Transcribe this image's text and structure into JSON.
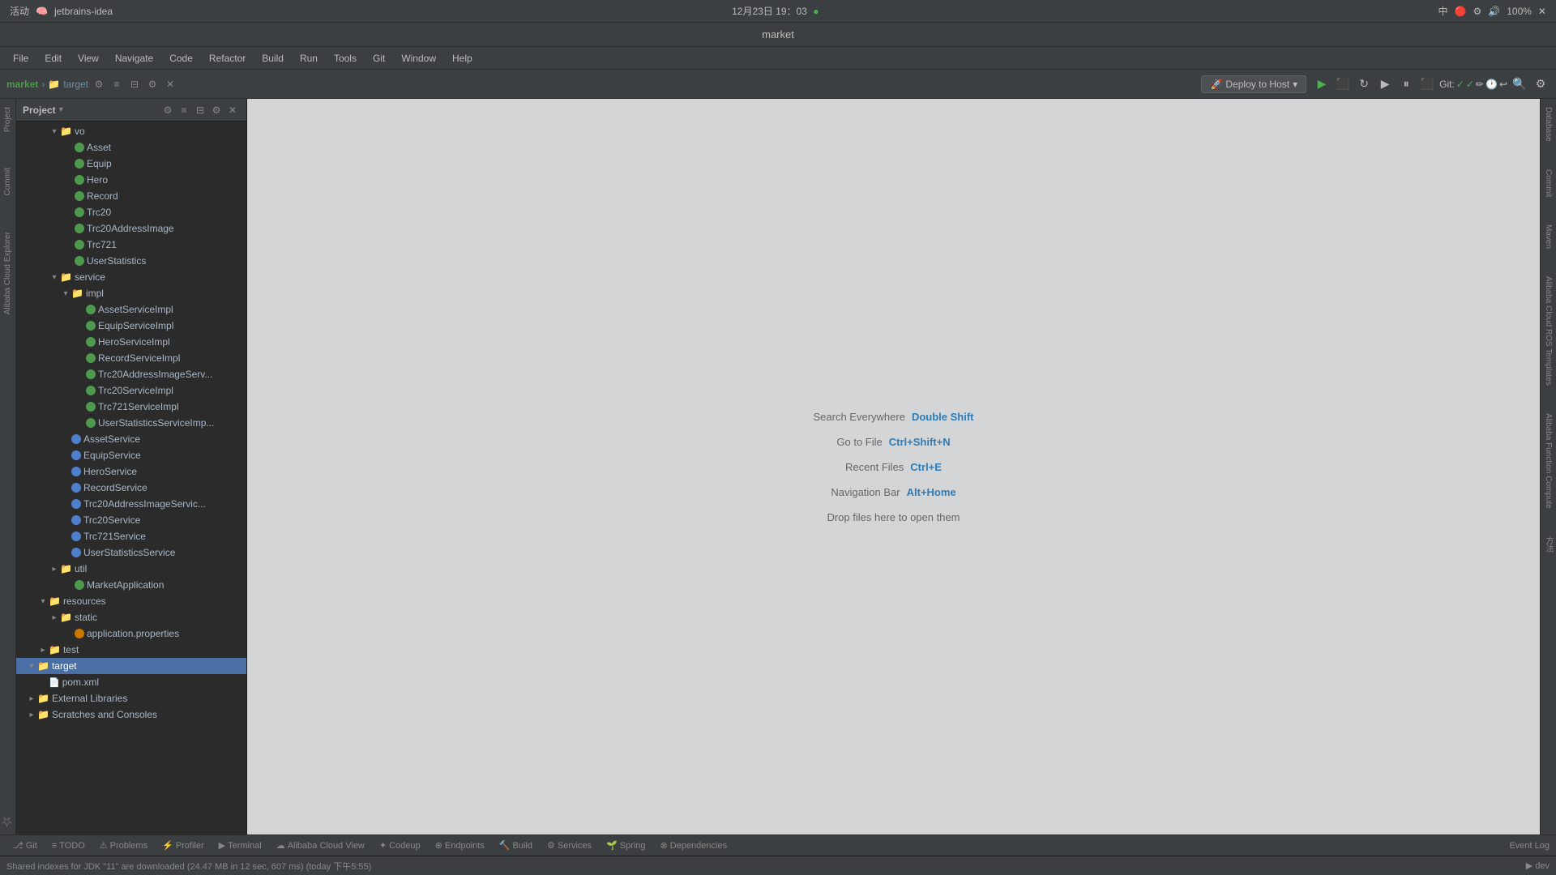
{
  "systemBar": {
    "leftText": "活动",
    "appName": "jetbrains-idea",
    "centerText": "12月23日 19：03",
    "indicator": "●",
    "rightText": "中",
    "battery": "100%"
  },
  "titleBar": {
    "title": "market"
  },
  "menuBar": {
    "items": [
      "File",
      "Edit",
      "View",
      "Navigate",
      "Code",
      "Refactor",
      "Build",
      "Run",
      "Tools",
      "Git",
      "Window",
      "Help"
    ]
  },
  "toolbar": {
    "project": "market",
    "separator": "›",
    "target": "target",
    "deployBtn": "Deploy to Host",
    "gitLabel": "Git:"
  },
  "projectPanel": {
    "title": "Project",
    "tree": [
      {
        "indent": 3,
        "type": "folder",
        "label": "vo",
        "collapsed": false
      },
      {
        "indent": 4,
        "type": "class",
        "label": "Asset",
        "color": "green"
      },
      {
        "indent": 4,
        "type": "class",
        "label": "Equip",
        "color": "green"
      },
      {
        "indent": 4,
        "type": "class",
        "label": "Hero",
        "color": "green"
      },
      {
        "indent": 4,
        "type": "class",
        "label": "Record",
        "color": "green"
      },
      {
        "indent": 4,
        "type": "class",
        "label": "Trc20",
        "color": "green"
      },
      {
        "indent": 4,
        "type": "class",
        "label": "Trc20AddressImage",
        "color": "green"
      },
      {
        "indent": 4,
        "type": "class",
        "label": "Trc721",
        "color": "green"
      },
      {
        "indent": 4,
        "type": "class",
        "label": "UserStatistics",
        "color": "green"
      },
      {
        "indent": 3,
        "type": "folder",
        "label": "service",
        "collapsed": false
      },
      {
        "indent": 4,
        "type": "folder",
        "label": "impl",
        "collapsed": false
      },
      {
        "indent": 5,
        "type": "class",
        "label": "AssetServiceImpl",
        "color": "green"
      },
      {
        "indent": 5,
        "type": "class",
        "label": "EquipServiceImpl",
        "color": "green"
      },
      {
        "indent": 5,
        "type": "class",
        "label": "HeroServiceImpl",
        "color": "green"
      },
      {
        "indent": 5,
        "type": "class",
        "label": "RecordServiceImpl",
        "color": "green"
      },
      {
        "indent": 5,
        "type": "class",
        "label": "Trc20AddressImageServ...",
        "color": "green"
      },
      {
        "indent": 5,
        "type": "class",
        "label": "Trc20ServiceImpl",
        "color": "green"
      },
      {
        "indent": 5,
        "type": "class",
        "label": "Trc721ServiceImpl",
        "color": "green"
      },
      {
        "indent": 5,
        "type": "class",
        "label": "UserStatisticsServiceImp...",
        "color": "green"
      },
      {
        "indent": 4,
        "type": "interface",
        "label": "AssetService",
        "color": "blue"
      },
      {
        "indent": 4,
        "type": "interface",
        "label": "EquipService",
        "color": "blue"
      },
      {
        "indent": 4,
        "type": "interface",
        "label": "HeroService",
        "color": "blue"
      },
      {
        "indent": 4,
        "type": "interface",
        "label": "RecordService",
        "color": "blue"
      },
      {
        "indent": 4,
        "type": "interface",
        "label": "Trc20AddressImageServic...",
        "color": "blue"
      },
      {
        "indent": 4,
        "type": "interface",
        "label": "Trc20Service",
        "color": "blue"
      },
      {
        "indent": 4,
        "type": "interface",
        "label": "Trc721Service",
        "color": "blue"
      },
      {
        "indent": 4,
        "type": "interface",
        "label": "UserStatisticsService",
        "color": "blue"
      },
      {
        "indent": 3,
        "type": "folder",
        "label": "util",
        "collapsed": true
      },
      {
        "indent": 4,
        "type": "class",
        "label": "MarketApplication",
        "color": "green"
      },
      {
        "indent": 2,
        "type": "folder",
        "label": "resources",
        "collapsed": false
      },
      {
        "indent": 3,
        "type": "folder",
        "label": "static",
        "collapsed": true
      },
      {
        "indent": 4,
        "type": "properties",
        "label": "application.properties",
        "color": "orange"
      },
      {
        "indent": 2,
        "type": "folder",
        "label": "test",
        "collapsed": true
      },
      {
        "indent": 1,
        "type": "folder",
        "label": "target",
        "selected": true
      },
      {
        "indent": 1,
        "type": "xml",
        "label": "pom.xml"
      },
      {
        "indent": 0,
        "type": "folder",
        "label": "External Libraries",
        "collapsed": true
      },
      {
        "indent": 0,
        "type": "folder",
        "label": "Scratches and Consoles",
        "collapsed": true
      }
    ]
  },
  "editorArea": {
    "hints": [
      {
        "text": "Search Everywhere",
        "key": "Double Shift"
      },
      {
        "text": "Go to File",
        "key": "Ctrl+Shift+N"
      },
      {
        "text": "Recent Files",
        "key": "Ctrl+E"
      },
      {
        "text": "Navigation Bar",
        "key": "Alt+Home"
      },
      {
        "text": "Drop files here to open them",
        "key": ""
      }
    ]
  },
  "rightTabs": [
    "Database",
    "Commit",
    "Maven",
    "Alibaba Cloud ROS Templates",
    "Alibaba Function Compute",
    "方法"
  ],
  "leftTabs": [
    "Project",
    "Commit",
    "Alibaba Cloud Explorer"
  ],
  "bottomTabs": [
    {
      "icon": "⎇",
      "label": "Git"
    },
    {
      "icon": "≡",
      "label": "TODO"
    },
    {
      "icon": "⚠",
      "label": "Problems"
    },
    {
      "icon": "⚡",
      "label": "Profiler"
    },
    {
      "icon": "▶",
      "label": "Terminal"
    },
    {
      "icon": "☁",
      "label": "Alibaba Cloud View"
    },
    {
      "icon": "✦",
      "label": "Codeup"
    },
    {
      "icon": "⊕",
      "label": "Endpoints"
    },
    {
      "icon": "🔨",
      "label": "Build"
    },
    {
      "icon": "⚙",
      "label": "Services"
    },
    {
      "icon": "🌱",
      "label": "Spring"
    },
    {
      "icon": "⊗",
      "label": "Dependencies"
    }
  ],
  "eventLog": "Event Log",
  "statusBar": {
    "text": "Shared indexes for JDK \"11\" are downloaded (24.47 MB in 12 sec, 607 ms) (today 下午5:55)",
    "rightItems": [
      "▶ dev"
    ]
  }
}
